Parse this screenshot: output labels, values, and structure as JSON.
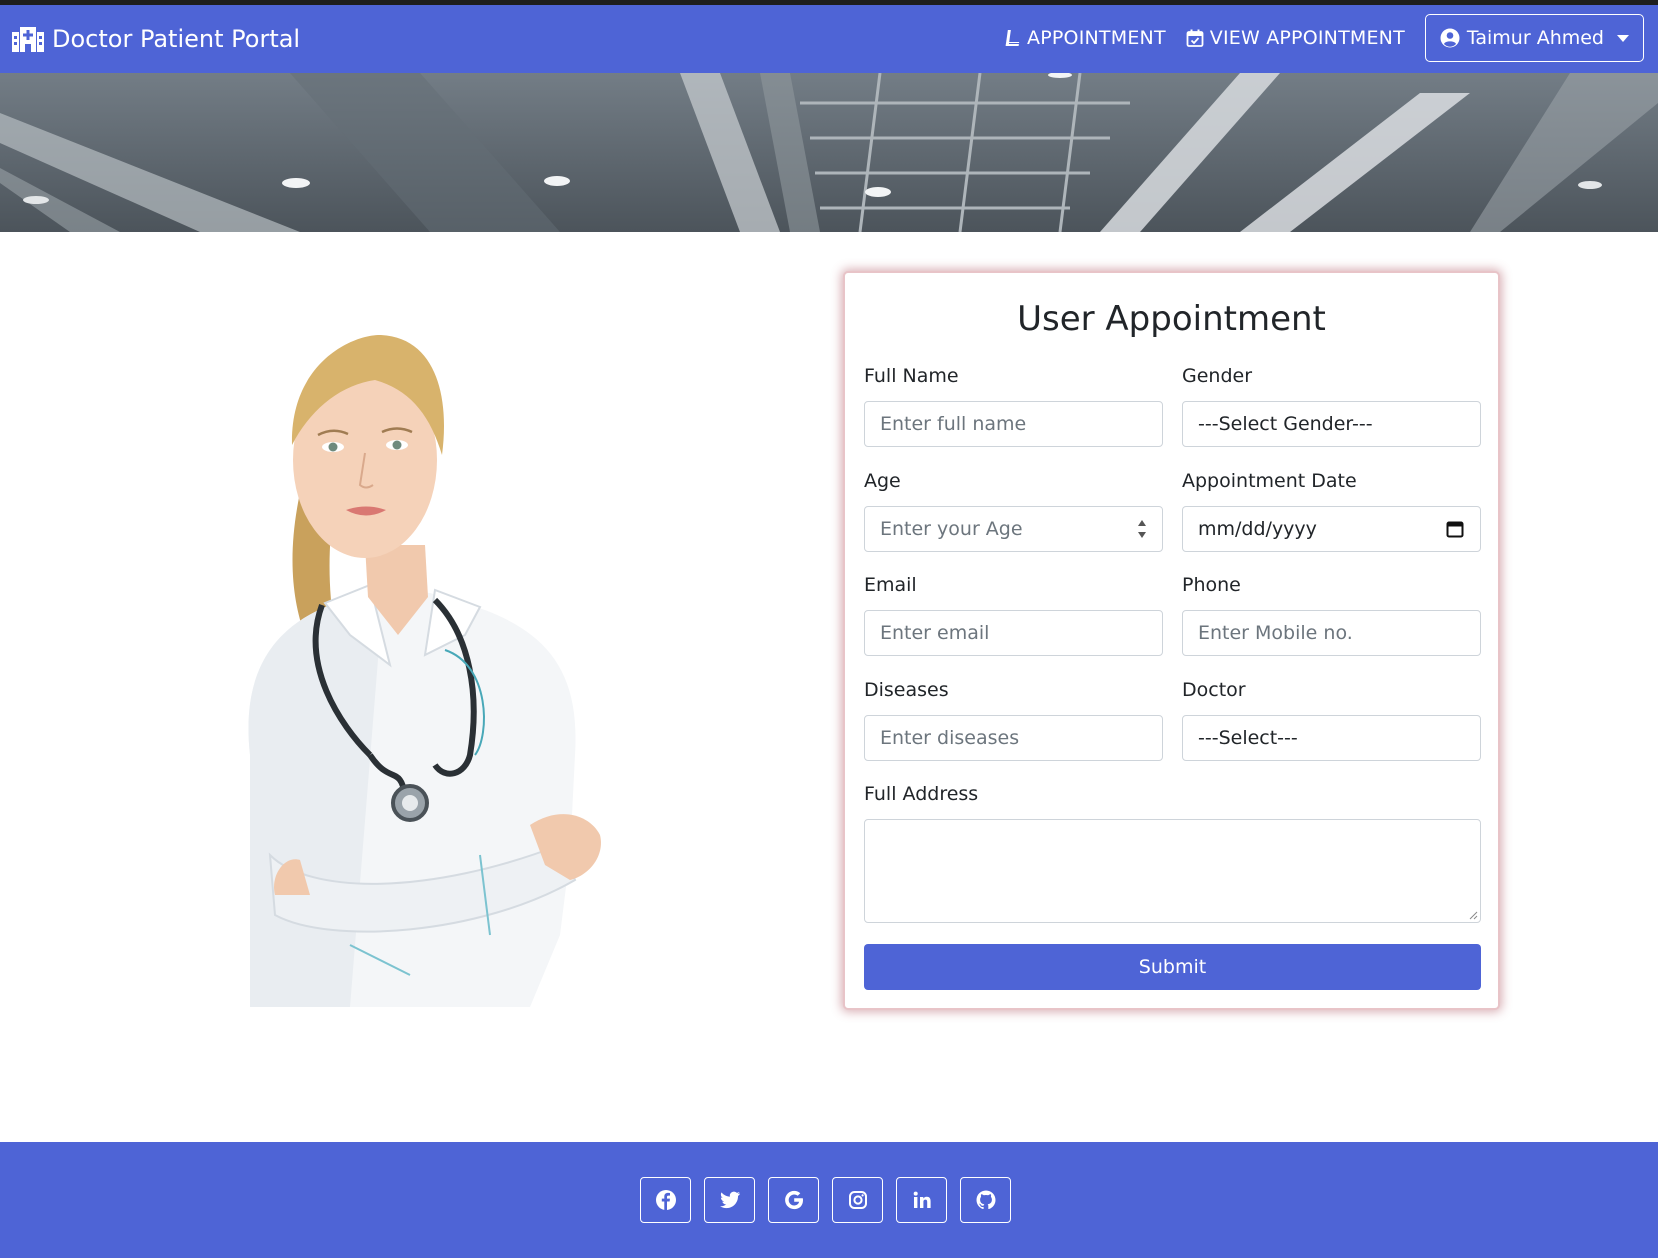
{
  "app": {
    "title": "Doctor Patient Portal"
  },
  "nav": {
    "appointment_label": "APPOINTMENT",
    "view_appointment_label": "VIEW APPOINTMENT",
    "user_name": "Taimur Ahmed"
  },
  "form": {
    "title": "User Appointment",
    "full_name": {
      "label": "Full Name",
      "placeholder": "Enter full name"
    },
    "gender": {
      "label": "Gender",
      "value": "---Select Gender---"
    },
    "age": {
      "label": "Age",
      "placeholder": "Enter your Age"
    },
    "appointment_date": {
      "label": "Appointment Date",
      "value": "mm/dd/yyyy"
    },
    "email": {
      "label": "Email",
      "placeholder": "Enter email"
    },
    "phone": {
      "label": "Phone",
      "placeholder": "Enter Mobile no."
    },
    "diseases": {
      "label": "Diseases",
      "placeholder": "Enter diseases"
    },
    "doctor": {
      "label": "Doctor",
      "value": "---Select---"
    },
    "address": {
      "label": "Full Address",
      "value": ""
    },
    "submit_label": "Submit"
  },
  "footer": {
    "social_icons": [
      "facebook-icon",
      "twitter-icon",
      "google-icon",
      "instagram-icon",
      "linkedin-icon",
      "github-icon"
    ]
  },
  "colors": {
    "primary": "#4e64d6",
    "card_shadow": "#c98a92",
    "border": "#ced4da"
  }
}
